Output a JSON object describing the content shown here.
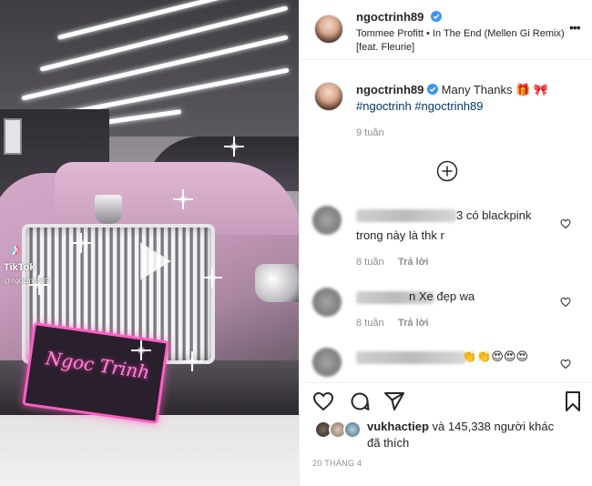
{
  "media": {
    "tiktok_label": "TikTok",
    "tiktok_handle": "@ngoctrinh89",
    "plate_text": "Ngoc Trinh"
  },
  "post": {
    "author": "ngoctrinh89",
    "music": "Tommee Profitt • In The End (Mellen Gi Remix) [feat. Fleurie]",
    "caption_text": "Many Thanks 🎁 🎀",
    "hashtags": "#ngoctrinh #ngoctrinh89",
    "caption_time": "9 tuần"
  },
  "comments": [
    {
      "text_visible": "3 có blackpink",
      "text_line2": "trong này là thk r",
      "time": "8 tuần",
      "reply": "Trả lời"
    },
    {
      "text_visible": "n Xe đẹp wa",
      "time": "8 tuần",
      "reply": "Trả lời"
    },
    {
      "text_visible": "👏👏😍😍😍"
    }
  ],
  "likes": {
    "first_liker": "vukhactiep",
    "rest": "và 145,338 người khác",
    "suffix": "đã thích"
  },
  "date": "20 THÁNG 4",
  "colors": {
    "hashtag": "#00376b",
    "verified": "#3897f0",
    "muted": "#8e8e8e"
  }
}
